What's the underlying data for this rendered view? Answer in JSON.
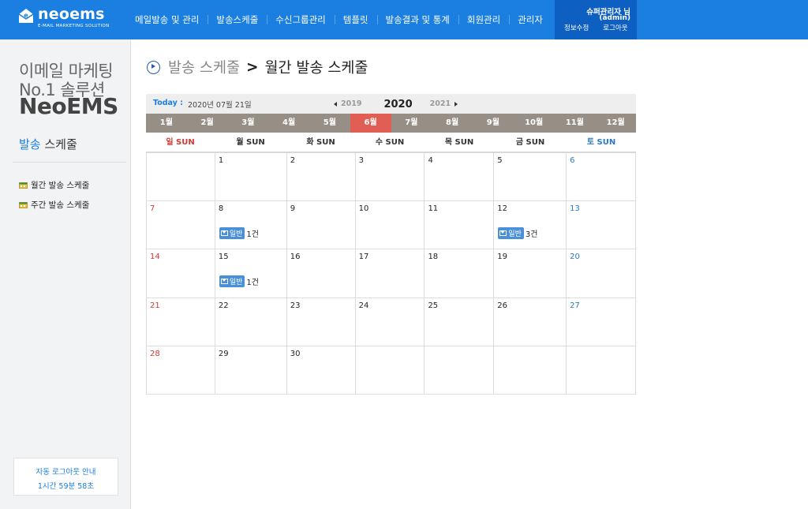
{
  "header": {
    "logo_text": "neoems",
    "logo_sub": "E-MAIL MARKETING SOLUTION",
    "nav": [
      "메일발송 및 관리",
      "발송스케줄",
      "수신그룹관리",
      "템플릿",
      "발송결과 및 통계",
      "회원관리",
      "관리자"
    ],
    "user_name": "슈퍼관리자 님",
    "user_id": "(admin)",
    "edit_info": "정보수정",
    "logout": "로그아웃",
    "brand_color": "#1a7fe0"
  },
  "sidebar": {
    "slogan_line1": "이메일 마케팅",
    "slogan_line2": "No.1 솔루션",
    "brand": "NeoEMS",
    "section_highlight": "발송",
    "section_rest": " 스케줄",
    "menu": [
      {
        "label": "월간 발송 스케줄",
        "icon": "calendar-icon"
      },
      {
        "label": "주간 발송 스케줄",
        "icon": "calendar-icon"
      }
    ],
    "autologout_title": "자동 로그아웃 안내",
    "autologout_time": "1시간 59분 58초"
  },
  "breadcrumb": {
    "parent": "발송 스케줄",
    "separator": ">",
    "current": "월간 발송 스케줄"
  },
  "calendar": {
    "today_label": "Today",
    "today_colon": ":",
    "today_date": "2020년 07월 21일",
    "prev_year": "2019",
    "current_year": "2020",
    "next_year": "2021",
    "months": [
      "1월",
      "2월",
      "3월",
      "4월",
      "5월",
      "6월",
      "7월",
      "8월",
      "9월",
      "10월",
      "11월",
      "12월"
    ],
    "active_month_index": 5,
    "weekdays": [
      "일 SUN",
      "월 SUN",
      "화 SUN",
      "수 SUN",
      "목 SUN",
      "금 SUN",
      "토 SUN"
    ],
    "weeks": [
      [
        {
          "day": ""
        },
        {
          "day": "1"
        },
        {
          "day": "2"
        },
        {
          "day": "3"
        },
        {
          "day": "4"
        },
        {
          "day": "5"
        },
        {
          "day": "6"
        }
      ],
      [
        {
          "day": "7"
        },
        {
          "day": "8",
          "event": {
            "type": "일반",
            "count": "1건"
          }
        },
        {
          "day": "9"
        },
        {
          "day": "10"
        },
        {
          "day": "11"
        },
        {
          "day": "12",
          "event": {
            "type": "일반",
            "count": "3건"
          }
        },
        {
          "day": "13"
        }
      ],
      [
        {
          "day": "14"
        },
        {
          "day": "15",
          "event": {
            "type": "일반",
            "count": "1건"
          }
        },
        {
          "day": "16"
        },
        {
          "day": "17"
        },
        {
          "day": "18"
        },
        {
          "day": "19"
        },
        {
          "day": "20"
        }
      ],
      [
        {
          "day": "21"
        },
        {
          "day": "22"
        },
        {
          "day": "23"
        },
        {
          "day": "24"
        },
        {
          "day": "25"
        },
        {
          "day": "26"
        },
        {
          "day": "27"
        }
      ],
      [
        {
          "day": "28"
        },
        {
          "day": "29"
        },
        {
          "day": "30"
        },
        {
          "day": ""
        },
        {
          "day": ""
        },
        {
          "day": ""
        },
        {
          "day": ""
        }
      ]
    ]
  }
}
